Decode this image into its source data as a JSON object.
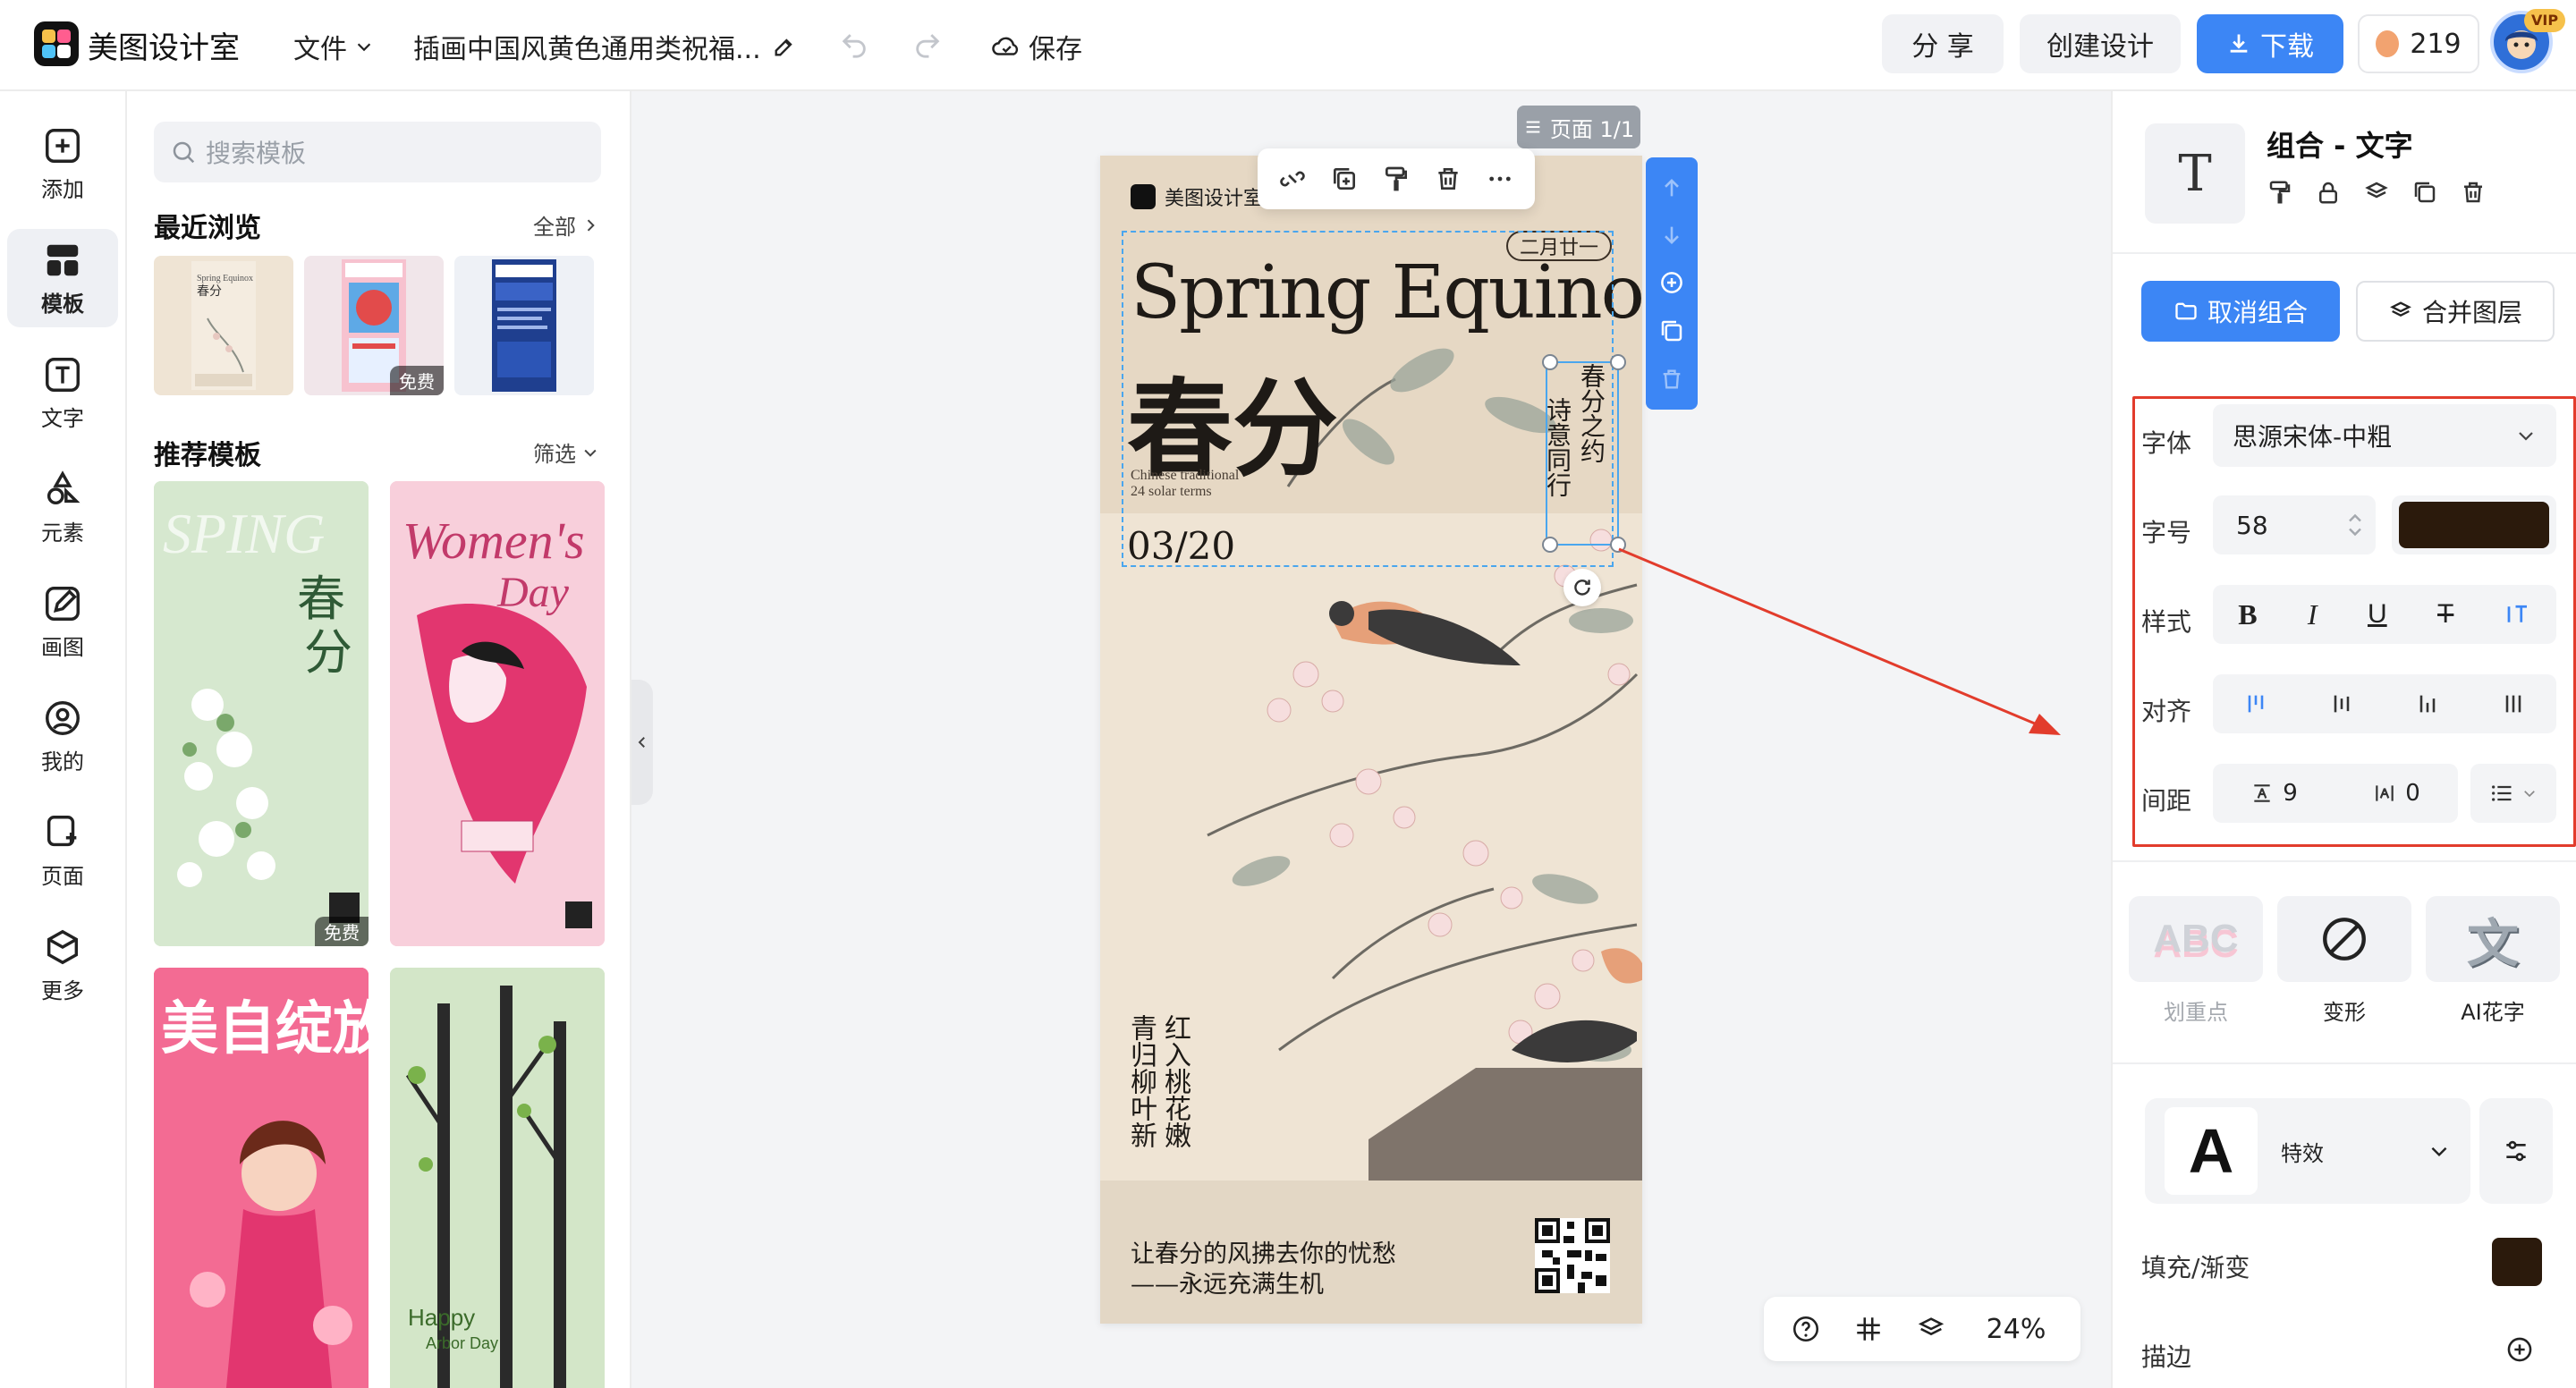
{
  "topbar": {
    "app_name": "美图设计室",
    "file_menu": "文件",
    "doc_title": "插画中国风黄色通用类祝福...",
    "save": "保存",
    "share": "分 享",
    "create": "创建设计",
    "download": "下载",
    "coins": "219",
    "vip": "VIP"
  },
  "rail": {
    "items": [
      {
        "label": "添加",
        "icon": "add-icon"
      },
      {
        "label": "模板",
        "icon": "template-icon"
      },
      {
        "label": "文字",
        "icon": "text-icon"
      },
      {
        "label": "元素",
        "icon": "element-icon"
      },
      {
        "label": "画图",
        "icon": "draw-icon"
      },
      {
        "label": "我的",
        "icon": "user-icon"
      },
      {
        "label": "页面",
        "icon": "page-icon"
      },
      {
        "label": "更多",
        "icon": "more-icon"
      }
    ]
  },
  "panel": {
    "search_placeholder": "搜索模板",
    "recent_title": "最近浏览",
    "recent_all": "全部",
    "recommend_title": "推荐模板",
    "filter": "筛选",
    "free_badge": "免费"
  },
  "canvas": {
    "page_indicator": "页面 1/1",
    "zoom": "24%"
  },
  "poster": {
    "brand": "美图设计室",
    "headline": "Spring Equinox",
    "cn_title": "春分",
    "date_chip": "二月廿一",
    "sub_en_1": "Chinese traditional",
    "sub_en_2": "24 solar terms",
    "vert_1": "春分之约",
    "vert_2": "诗意同行",
    "date": "03/20",
    "poem": [
      "红入桃花嫩",
      "青归柳叶新"
    ],
    "slogan_1": "让春分的风拂去你的忧愁",
    "slogan_2": "——永远充满生机"
  },
  "rpanel": {
    "title": "组合 - 文字",
    "ungroup": "取消组合",
    "merge": "合并图层",
    "font_label": "字体",
    "font_value": "思源宋体-中粗",
    "size_label": "字号",
    "size_value": "58",
    "text_color": "#2b1a0c",
    "style_label": "样式",
    "align_label": "对齐",
    "spacing_label": "间距",
    "line_spacing": "9",
    "letter_spacing": "0",
    "fx": [
      {
        "label": "划重点",
        "glyph": "ABC"
      },
      {
        "label": "变形",
        "glyph": ""
      },
      {
        "label": "AI花字",
        "glyph": "文"
      }
    ],
    "effect_glyph": "A",
    "effect_label": "特效",
    "fill_label": "填充/渐变",
    "stroke_label": "描边"
  },
  "colors": {
    "accent": "#3c86f5",
    "annotation": "#e23c2c",
    "poster_bg": "#efe4d4"
  }
}
